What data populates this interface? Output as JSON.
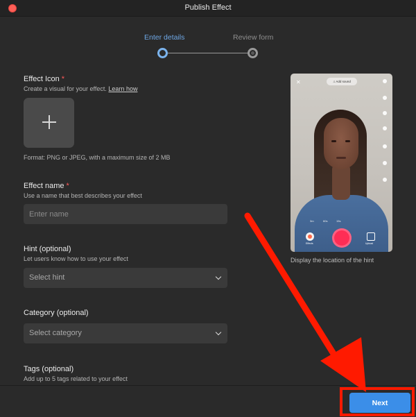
{
  "window": {
    "title": "Publish Effect"
  },
  "stepper": {
    "step1": "Enter details",
    "step2": "Review form"
  },
  "effect_icon": {
    "label": "Effect Icon",
    "required_mark": "*",
    "help": "Create a visual for your effect.",
    "learn_link": "Learn how",
    "format_note": "Format: PNG or JPEG, with a maximum size of 2 MB"
  },
  "effect_name": {
    "label": "Effect name",
    "required_mark": "*",
    "help": "Use a name that best describes your effect",
    "placeholder": "Enter name"
  },
  "hint": {
    "label": "Hint (optional)",
    "help": "Let users know how to use your effect",
    "selected": "Select hint"
  },
  "category": {
    "label": "Category (optional)",
    "selected": "Select category"
  },
  "tags": {
    "label": "Tags (optional)",
    "help": "Add up to 5 tags related to your effect"
  },
  "preview": {
    "add_sound": "Add sound",
    "caption": "Display the location of the hint",
    "speed_options": [
      "3m",
      "60s",
      "15s"
    ],
    "effects_label": "Effects",
    "upload_label": "Upload"
  },
  "footer": {
    "next_label": "Next"
  },
  "colors": {
    "accent": "#3b8ee8",
    "annotation": "#ff1a00",
    "record": "#ff2d55"
  }
}
